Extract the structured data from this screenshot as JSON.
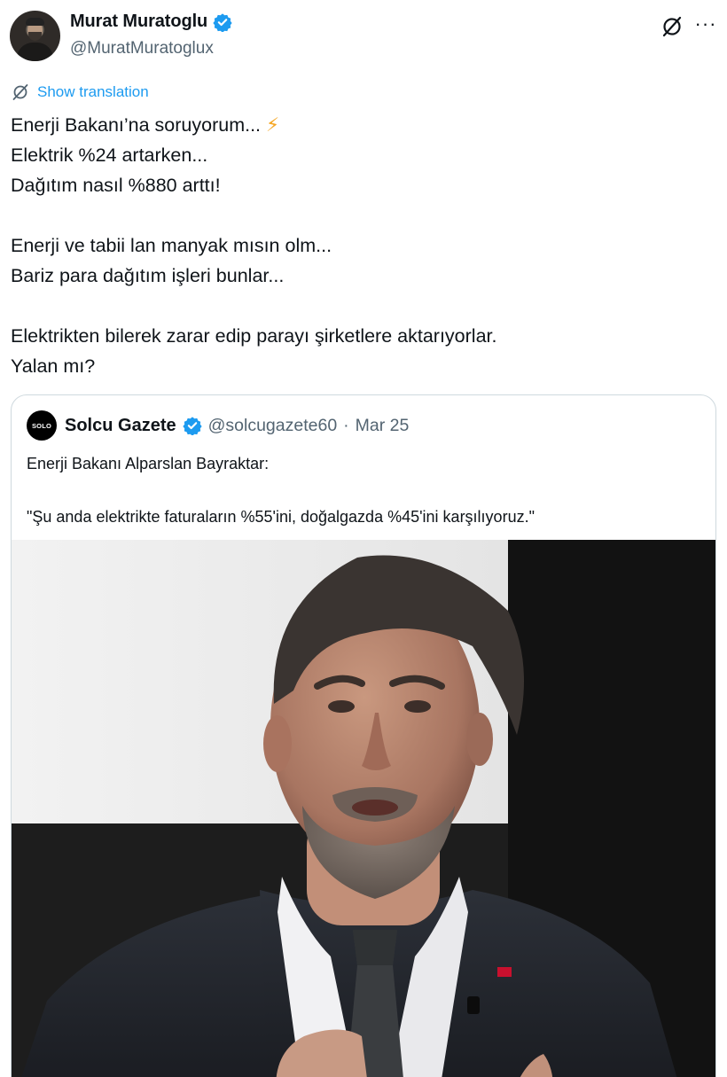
{
  "author": {
    "display_name": "Murat Muratoglu",
    "handle": "@MuratMuratoglux",
    "verified": true
  },
  "actions": {
    "grok_icon": "grok-slash-circle-icon",
    "more_label": "···"
  },
  "translation": {
    "label": "Show translation"
  },
  "tweet": {
    "lines": [
      "Enerji Bakanı’na soruyorum...",
      "Elektrik %24 artarken...",
      "Dağıtım nasıl %880 arttı!",
      "",
      "Enerji ve tabii lan manyak mısın olm...",
      "Bariz para dağıtım işleri bunlar...",
      "",
      "Elektrikten bilerek zarar edip parayı şirketlere aktarıyorlar.",
      "Yalan mı?"
    ],
    "emoji": "⚡"
  },
  "quote": {
    "avatar_text": "SOLO",
    "display_name": "Solcu Gazete",
    "verified": true,
    "handle": "@solcugazete60",
    "separator": "·",
    "date": "Mar 25",
    "lines": [
      "Enerji Bakanı Alparslan Bayraktar:",
      "",
      "\"Şu anda elektrikte faturaların %55'ini, doğalgazda %45'ini karşılıyoruz.\""
    ]
  },
  "colors": {
    "accent": "#1d9bf0",
    "secondary_text": "#536471",
    "primary_text": "#0f1419",
    "border": "#cfd9de"
  }
}
